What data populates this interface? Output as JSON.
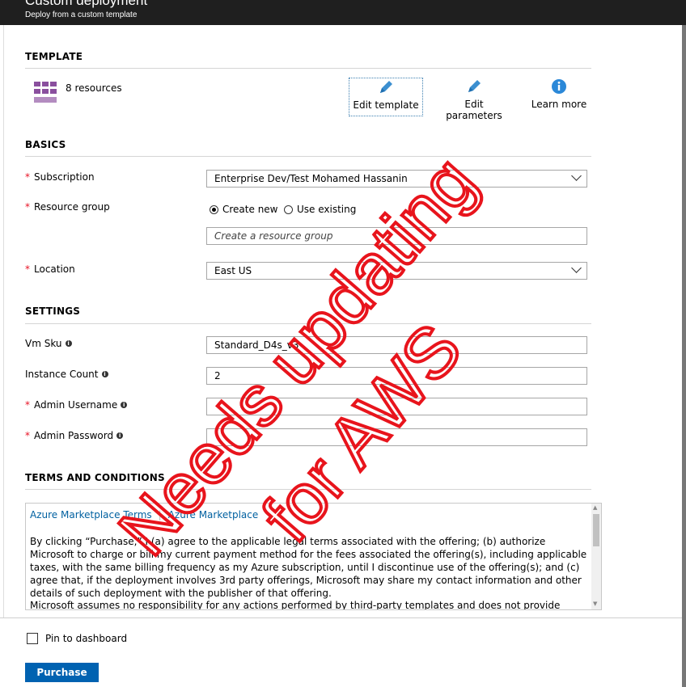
{
  "header": {
    "title": "Custom deployment",
    "subtitle": "Deploy from a custom template"
  },
  "template": {
    "section": "TEMPLATE",
    "resources": "8 resources",
    "buttons": [
      {
        "label": "Edit template",
        "icon": "pencil-icon"
      },
      {
        "label": "Edit parameters",
        "icon": "pencil-icon"
      },
      {
        "label": "Learn more",
        "icon": "info-icon"
      }
    ]
  },
  "basics": {
    "section": "BASICS",
    "subscription": {
      "label": "Subscription",
      "value": "Enterprise Dev/Test Mohamed Hassanin"
    },
    "resource_group": {
      "label": "Resource group",
      "create_new": "Create new",
      "use_existing": "Use existing",
      "selected": "Create new",
      "placeholder": "Create a resource group"
    },
    "location": {
      "label": "Location",
      "value": "East US"
    }
  },
  "settings": {
    "section": "SETTINGS",
    "vm_sku": {
      "label": "Vm Sku",
      "value": "Standard_D4s_v3"
    },
    "instance_count": {
      "label": "Instance Count",
      "value": "2"
    },
    "admin_username": {
      "label": "Admin Username",
      "value": ""
    },
    "admin_password": {
      "label": "Admin Password",
      "value": ""
    }
  },
  "terms": {
    "section": "TERMS AND CONDITIONS",
    "link1": "Azure Marketplace Terms",
    "link2": "Azure Marketplace",
    "para1": "By clicking “Purchase,” I (a) agree to the applicable legal terms associated with the offering; (b) authorize Microsoft to charge or bill my current payment method for the fees associated the offering(s), including applicable taxes, with the same billing frequency as my Azure subscription, until I discontinue use of the offering(s); and (c) agree that, if the deployment involves 3rd party offerings, Microsoft may share my contact information and other details of such deployment with the publisher of that offering.",
    "para2": "Microsoft assumes no responsibility for any actions performed by third-party templates and does not provide rights for third-"
  },
  "footer": {
    "pin_label": "Pin to dashboard",
    "purchase_label": "Purchase"
  },
  "overlay": {
    "line1": "Needs updating",
    "line2": "for AWS",
    "color": "#e8141c"
  },
  "colors": {
    "primary": "#0062b1",
    "required": "#e81123",
    "link": "#0060a0",
    "icon_purple": "#8a4f9e"
  }
}
